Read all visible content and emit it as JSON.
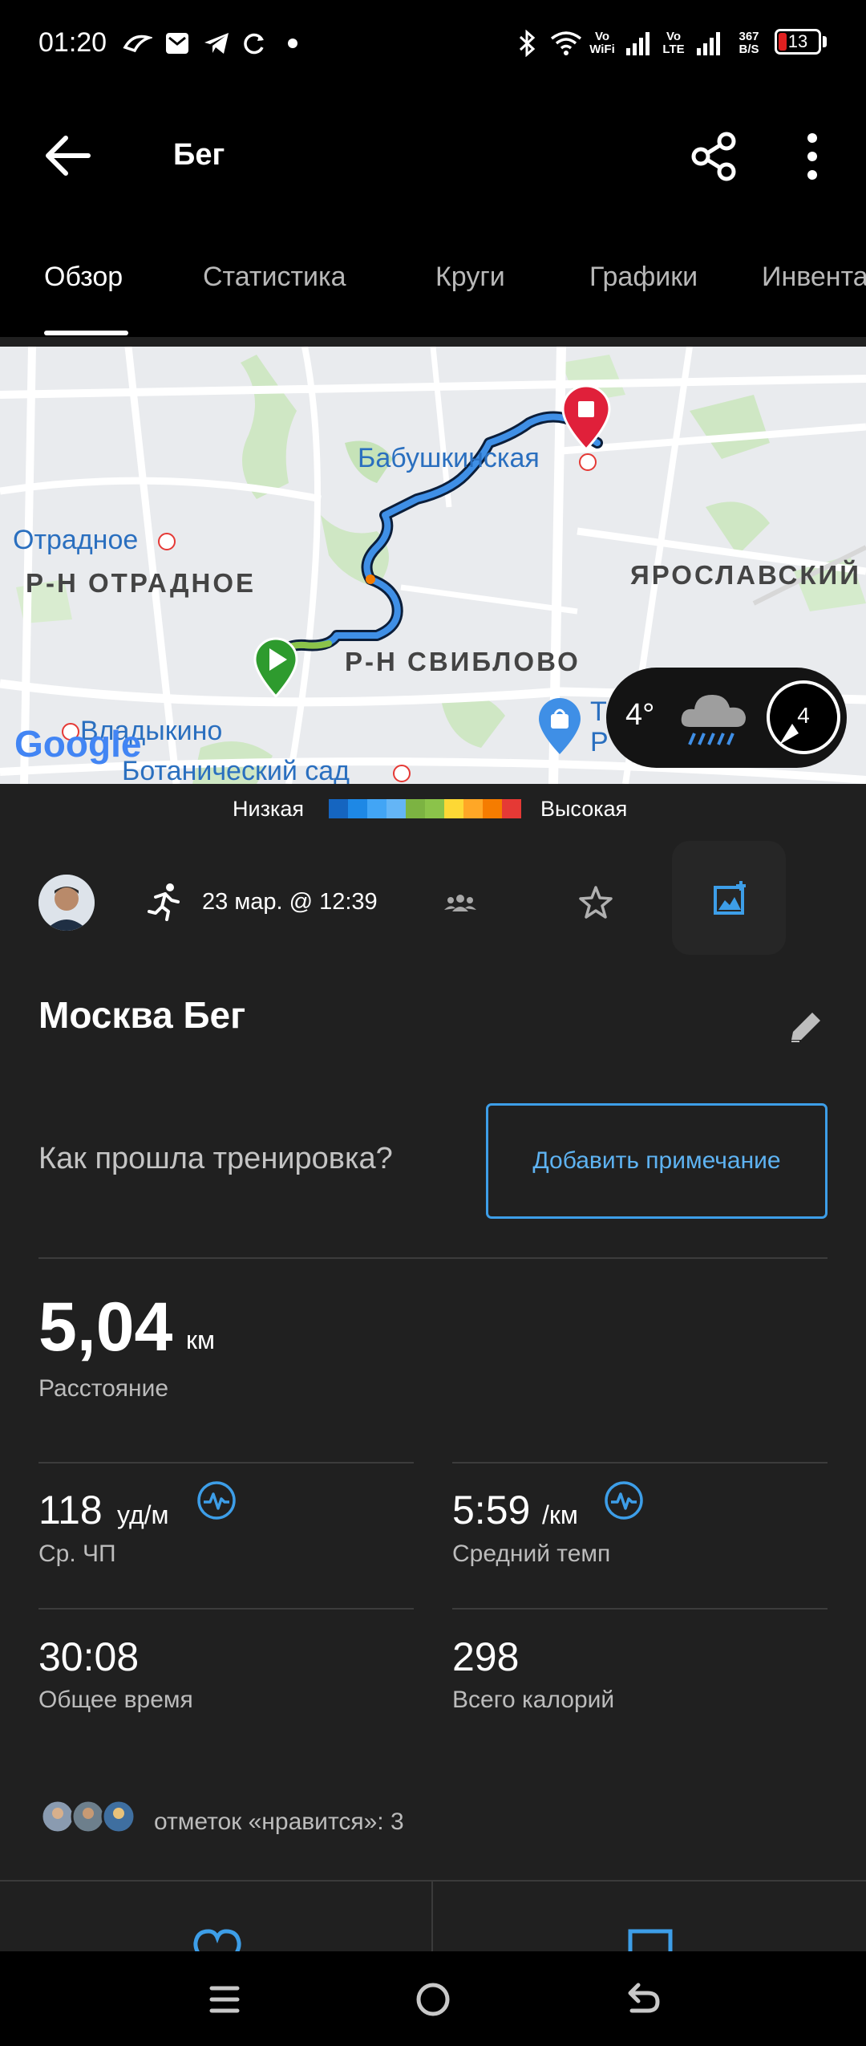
{
  "status_bar": {
    "time": "01:20",
    "vo_wifi": "Vo\nWiFi",
    "vo_lte": "Vo\nLTE",
    "net_speed": "367\nB/S",
    "battery": "13"
  },
  "app_bar": {
    "title": "Бег",
    "icons": [
      "back-arrow-icon",
      "share-icon",
      "more-vert-icon"
    ]
  },
  "tabs": [
    {
      "label": "Обзор",
      "active": true
    },
    {
      "label": "Статистика"
    },
    {
      "label": "Круги"
    },
    {
      "label": "Графики"
    },
    {
      "label": "Инвентарь"
    }
  ],
  "map": {
    "labels": {
      "babushkinskaya": "Бабушкинская",
      "otradnoe": "Отрадное",
      "rn_otradnoe": "Р-Н ОТРАДНОЕ",
      "yaroslavsky": "ЯРОСЛАВСКИЙ",
      "rn_sviblovo": "Р-Н СВИБЛОВО",
      "vladykino": "Владыкино",
      "botanical": "Ботанический сад",
      "partial_t": "Т",
      "partial_r": "Р"
    },
    "google": "Google",
    "weather": {
      "temp": "4°",
      "wind": "4"
    }
  },
  "legend": {
    "low": "Низкая",
    "high": "Высокая",
    "colors": [
      "#1565c0",
      "#1e88e5",
      "#42a5f5",
      "#64b5f6",
      "#7cb342",
      "#8bc34a",
      "#fdd835",
      "#ffa726",
      "#f57c00",
      "#e53935"
    ]
  },
  "activity": {
    "date": "23 мар. @ 12:39",
    "name": "Москва Бег",
    "prompt": "Как прошла тренировка?",
    "add_note": "Добавить примечание"
  },
  "stats": {
    "distance": {
      "value": "5,04",
      "unit": "км",
      "label": "Расстояние"
    },
    "avg_hr": {
      "value": "118",
      "unit": "уд/м",
      "label": "Ср. ЧП"
    },
    "avg_pace": {
      "value": "5:59",
      "unit": "/км",
      "label": "Средний темп"
    },
    "total_time": {
      "value": "30:08",
      "label": "Общее время"
    },
    "calories": {
      "value": "298",
      "label": "Всего калорий"
    }
  },
  "likes": {
    "text": "отметок «нравится»: 3"
  },
  "colors": {
    "accent": "#3d9ee8",
    "background": "#202020",
    "bar": "#000000"
  }
}
